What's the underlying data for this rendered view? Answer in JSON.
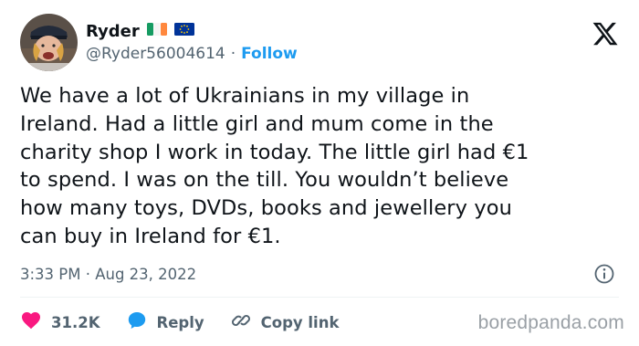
{
  "user": {
    "name": "Ryder",
    "handle": "@Ryder56004614",
    "separator": "·",
    "follow_label": "Follow"
  },
  "tweet": {
    "text": "We have a lot of Ukrainians in my village in\nIreland. Had a little girl and mum come in the\ncharity shop I work in today. The little girl had €1\nto spend. I was on the till. You wouldn’t believe\nhow many toys, DVDs, books and jewellery you\ncan buy in Ireland for €1.",
    "timestamp": "3:33 PM · Aug 23, 2022"
  },
  "actions": {
    "likes": "31.2K",
    "reply_label": "Reply",
    "copy_link_label": "Copy link"
  },
  "watermark": "boredpanda.com",
  "colors": {
    "text": "#0f1419",
    "muted": "#536471",
    "accent": "#1d9bf0",
    "like": "#f91880"
  },
  "icons": {
    "platform": "x-logo-icon",
    "irish_flag": "ireland-flag-icon",
    "eu_flag": "eu-flag-icon",
    "info": "info-icon",
    "like": "heart-icon",
    "reply": "reply-bubble-icon",
    "copy": "link-icon"
  }
}
